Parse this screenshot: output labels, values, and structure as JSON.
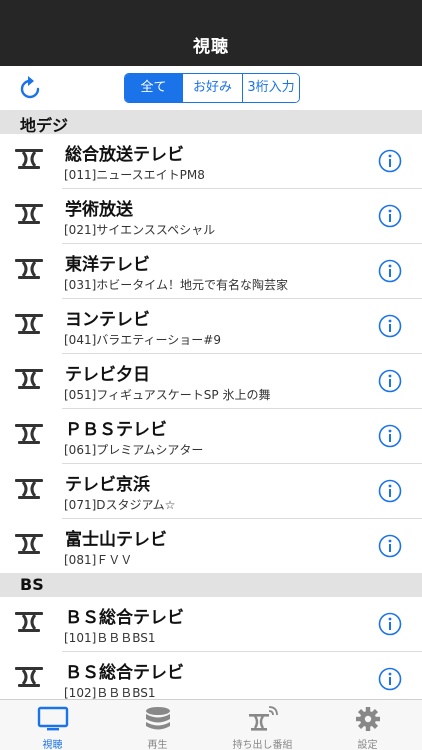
{
  "navbar": {
    "title": "視聴"
  },
  "segments": [
    {
      "label": "全て",
      "active": true
    },
    {
      "label": "お好み",
      "active": false
    },
    {
      "label": "3桁入力",
      "active": false
    }
  ],
  "sections": [
    {
      "title": "地デジ",
      "channels": [
        {
          "name": "総合放送テレビ",
          "program": "[011]ニュースエイトPM8"
        },
        {
          "name": "学術放送",
          "program": "[021]サイエンススペシャル"
        },
        {
          "name": "東洋テレビ",
          "program": "[031]ホビータイム！地元で有名な陶芸家"
        },
        {
          "name": "ヨンテレビ",
          "program": "[041]バラエティーショー#9"
        },
        {
          "name": "テレビ夕日",
          "program": "[051]フィギュアスケートSP 氷上の舞"
        },
        {
          "name": "ＰＢＳテレビ",
          "program": "[061]プレミアムシアター"
        },
        {
          "name": "テレビ京浜",
          "program": "[071]Dスタジアム☆"
        },
        {
          "name": "富士山テレビ",
          "program": "[081]ＦＶＶ"
        }
      ]
    },
    {
      "title": "BS",
      "channels": [
        {
          "name": "ＢＳ総合テレビ",
          "program": "[101]ＢＢＢBS1"
        },
        {
          "name": "ＢＳ総合テレビ",
          "program": "[102]ＢＢＢBS1"
        }
      ]
    }
  ],
  "tabs": [
    {
      "label": "視聴",
      "icon": "tv-icon",
      "active": true
    },
    {
      "label": "再生",
      "icon": "database-icon",
      "active": false
    },
    {
      "label": "持ち出し番組",
      "icon": "antenna-signal-icon",
      "active": false
    },
    {
      "label": "設定",
      "icon": "gear-icon",
      "active": false
    }
  ],
  "colors": {
    "accent": "#1a73e8",
    "navbar": "#262626",
    "section": "#e2e2e2"
  }
}
